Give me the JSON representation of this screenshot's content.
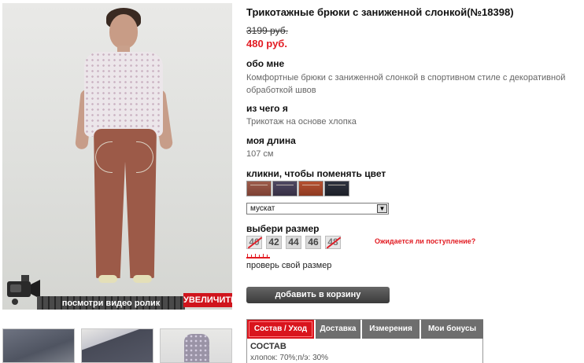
{
  "product": {
    "title": "Трикотажные брюки с заниженной слонкой(№18398)",
    "old_price": "3199 руб.",
    "new_price": "480 руб."
  },
  "media": {
    "video_label": "посмотри видео ролик",
    "zoom_label": "УВЕЛИЧИТЬ"
  },
  "about": {
    "heading": "обо мне",
    "text": "Комфортные брюки с заниженной слонкой в спортивном стиле с декоративной обработкой швов"
  },
  "material": {
    "heading": "из чего я",
    "text": "Трикотаж на основе хлопка"
  },
  "length": {
    "heading": "моя длина",
    "text": "107 см"
  },
  "color": {
    "heading": "кликни, чтобы поменять цвет",
    "selected": "мускат",
    "swatches": [
      "#9d5c4b",
      "#4f4962",
      "#b55232",
      "#2f3440"
    ]
  },
  "sizes": {
    "heading": "выбери размер",
    "items": [
      {
        "label": "40",
        "available": false
      },
      {
        "label": "42",
        "available": true
      },
      {
        "label": "44",
        "available": true
      },
      {
        "label": "46",
        "available": true
      },
      {
        "label": "48",
        "available": false
      }
    ],
    "availability_link": "Ожидается ли поступление?",
    "size_guide_link": "проверь свой размер"
  },
  "cart": {
    "button_label": "добавить в корзину"
  },
  "tabs": {
    "items": [
      "Состав / Уход",
      "Доставка",
      "Измерения",
      "Мои бонусы"
    ],
    "active": "Состав / Уход",
    "composition_title": "СОСТАВ",
    "composition_text": "хлопок: 70%;п/э: 30%"
  },
  "colors": {
    "accent": "#e21b22",
    "tab_inactive": "#6e6e6e",
    "button_dark": "#3a3a3a"
  }
}
